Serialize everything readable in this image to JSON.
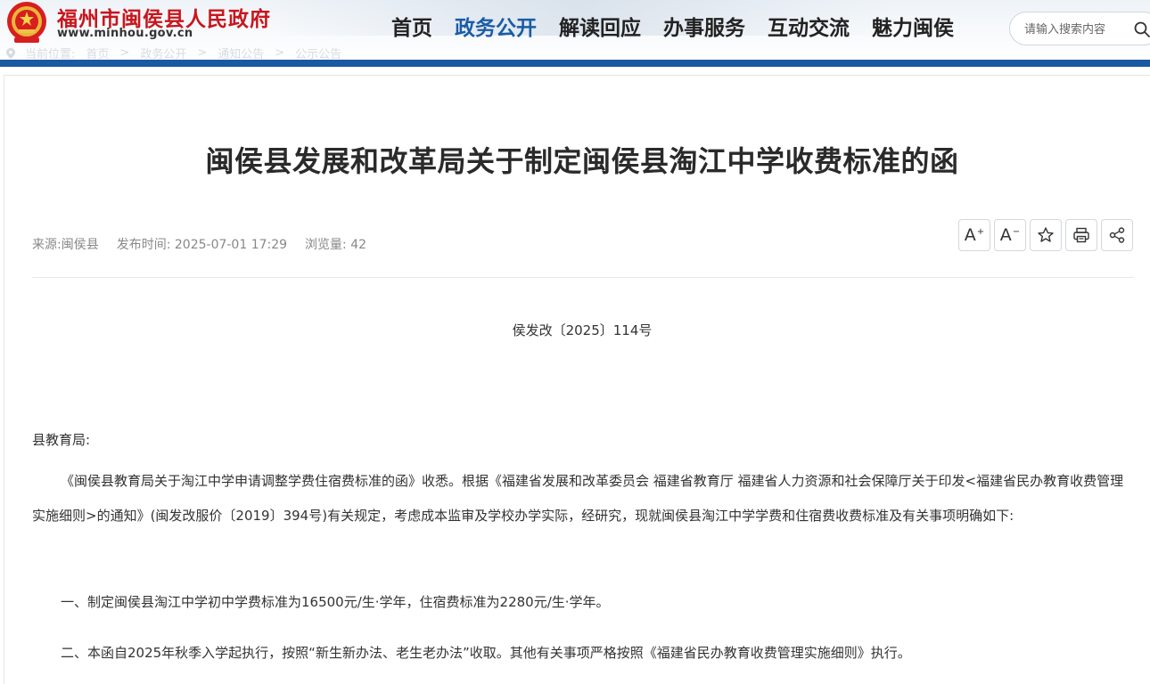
{
  "header": {
    "site_title": "福州市闽侯县人民政府",
    "site_url": "www.minhou.gov.cn",
    "nav": [
      {
        "label": "首页",
        "active": false
      },
      {
        "label": "政务公开",
        "active": true
      },
      {
        "label": "解读回应",
        "active": false
      },
      {
        "label": "办事服务",
        "active": false
      },
      {
        "label": "互动交流",
        "active": false
      },
      {
        "label": "魅力闽侯",
        "active": false
      }
    ],
    "search": {
      "placeholder": "请输入搜索内容"
    }
  },
  "breadcrumb": {
    "prefix": "当前位置:",
    "items": [
      "首页",
      "政务公开",
      "通知公告",
      "公示公告"
    ],
    "separator": ">"
  },
  "article": {
    "title": "闽侯县发展和改革局关于制定闽侯县淘江中学收费标准的函",
    "source": "来源:闽侯县",
    "publish_time": "发布时间: 2025-07-01 17:29",
    "views": "浏览量:  42",
    "tools": {
      "font_increase": "A",
      "font_decrease": "A",
      "increase_mark": "+",
      "decrease_mark": "−"
    },
    "doc_number": "侯发改〔2025〕114号",
    "addressee": "县教育局:",
    "paragraphs": [
      "《闽侯县教育局关于淘江中学申请调整学费住宿费标准的函》收悉。根据《福建省发展和改革委员会 福建省教育厅 福建省人力资源和社会保障厅关于印发<福建省民办教育收费管理实施细则>的通知》(闽发改服价〔2019〕394号)有关规定，考虑成本监审及学校办学实际，经研究，现就闽侯县淘江中学学费和住宿费收费标准及有关事项明确如下:",
      "一、制定闽侯县淘江中学初中学费标准为16500元/生·学年，住宿费标准为2280元/生·学年。",
      "二、本函自2025年秋季入学起执行，按照“新生新办法、老生老办法”收取。其他有关事项严格按照《福建省民办教育收费管理实施细则》执行。"
    ]
  },
  "colors": {
    "brand_red": "#c8161d",
    "nav_active": "#1a5ca6",
    "header_bar": "#1b5aa2"
  }
}
